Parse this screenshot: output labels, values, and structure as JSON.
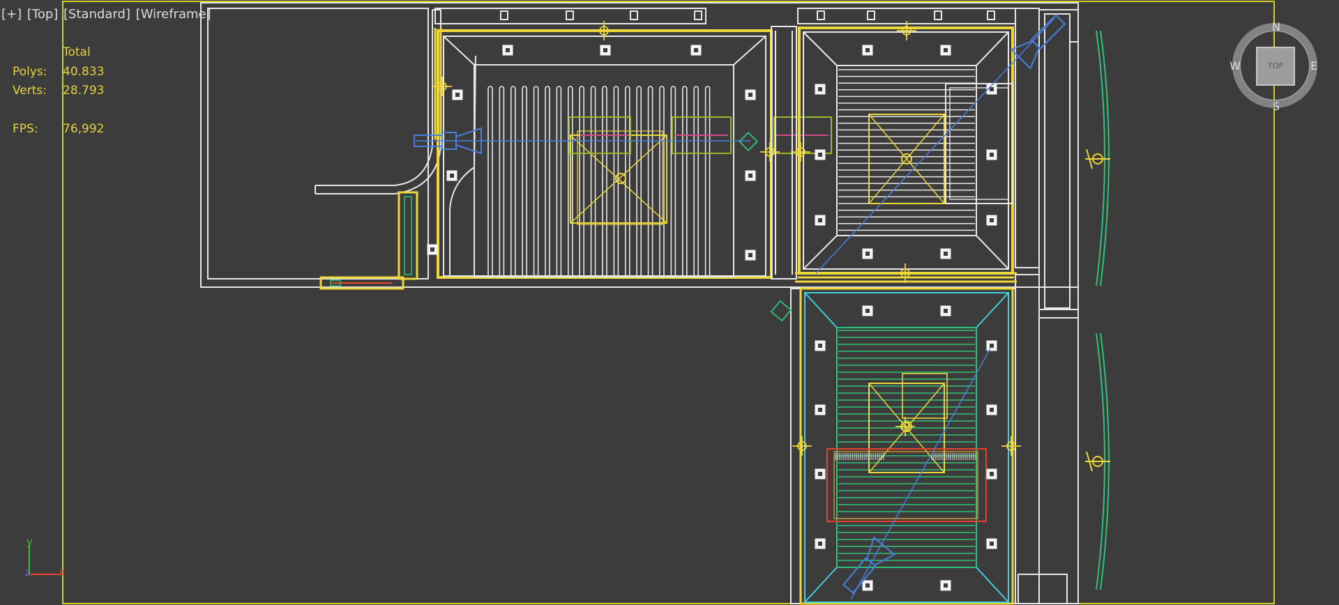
{
  "viewport_labels": {
    "plus": "[+]",
    "view": "[Top]",
    "shading_mode": "[Standard]",
    "display_mode": "[Wireframe]"
  },
  "stats": {
    "header": "Total",
    "polys_label": "Polys:",
    "polys_value": "40.833",
    "verts_label": "Verts:",
    "verts_value": "28.793",
    "fps_label": "FPS:",
    "fps_value": "76,992"
  },
  "viewcube": {
    "north": "N",
    "south": "S",
    "east": "E",
    "west": "W",
    "face": "TOP"
  },
  "axis_gizmo": {
    "y": "y",
    "x": "x",
    "z": "z"
  },
  "colors": {
    "background": "#3c3c3c",
    "wire_white": "#e8e8e8",
    "wire_yellow": "#ecd83a",
    "wire_green": "#2ec37a",
    "wire_cyan": "#3fd0e0",
    "wire_blue": "#4a7fe0",
    "wire_orange": "#e8442a",
    "safe_frame": "#d7cd2a"
  }
}
